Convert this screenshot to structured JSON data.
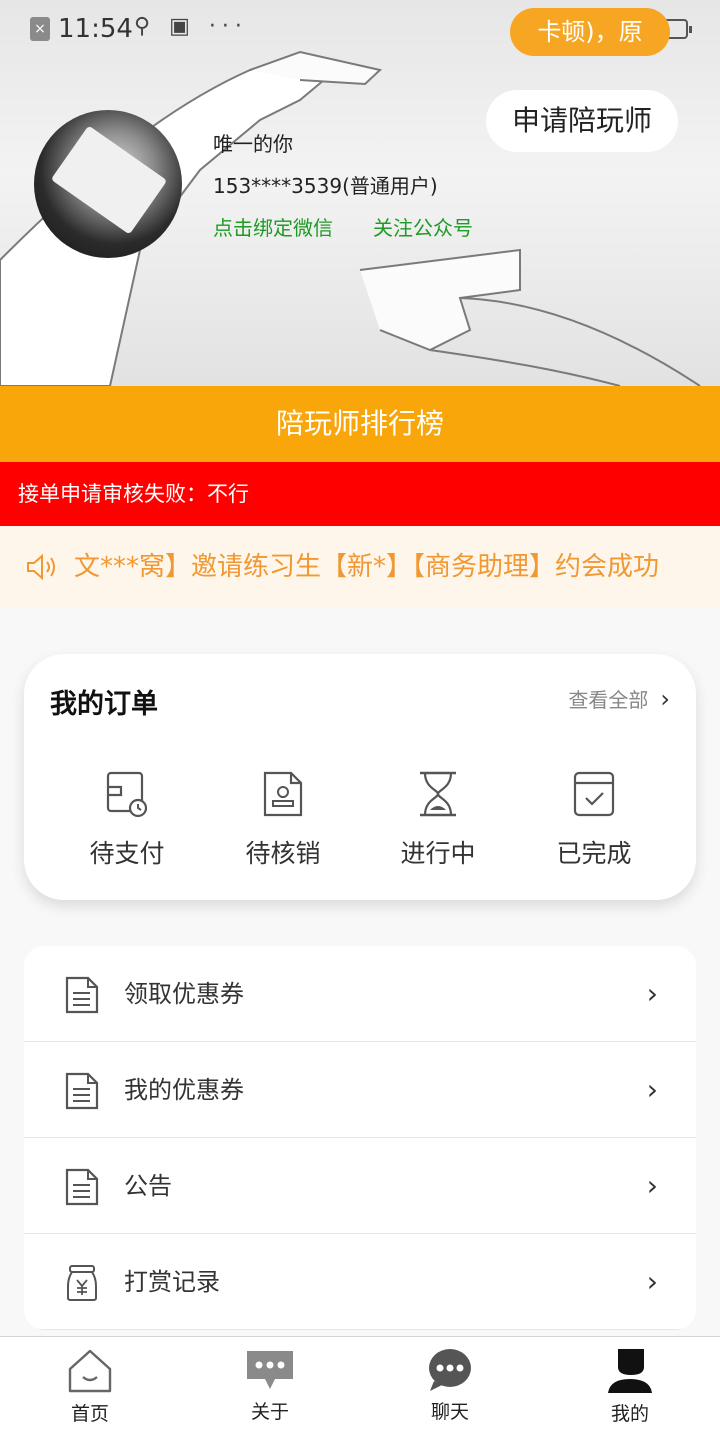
{
  "status_bar": {
    "time": "11:54",
    "toast": "卡顿)，原"
  },
  "profile": {
    "name": "唯一的你",
    "phone": "153****3539(普通用户)",
    "bind_wechat": "点击绑定微信",
    "follow_account": "关注公众号",
    "apply_button": "申请陪玩师"
  },
  "rank_bar": "陪玩师排行榜",
  "alert_bar": "接单申请审核失败：不行",
  "notice": {
    "icon": "speaker-icon",
    "text": "文***窝】邀请练习生【新*】【商务助理】约会成功"
  },
  "orders": {
    "title": "我的订单",
    "view_all": "查看全部",
    "items": [
      {
        "label": "待支付",
        "icon": "wallet-clock-icon"
      },
      {
        "label": "待核销",
        "icon": "stamp-document-icon"
      },
      {
        "label": "进行中",
        "icon": "hourglass-icon"
      },
      {
        "label": "已完成",
        "icon": "calendar-check-icon"
      }
    ]
  },
  "menu": [
    {
      "label": "领取优惠券",
      "icon": "document-icon"
    },
    {
      "label": "我的优惠券",
      "icon": "document-icon"
    },
    {
      "label": "公告",
      "icon": "document-icon"
    },
    {
      "label": "打赏记录",
      "icon": "yuan-jar-icon"
    }
  ],
  "tabbar": [
    {
      "label": "首页",
      "icon": "home-icon"
    },
    {
      "label": "关于",
      "icon": "message-icon"
    },
    {
      "label": "聊天",
      "icon": "chat-bubble-icon"
    },
    {
      "label": "我的",
      "icon": "user-icon"
    }
  ],
  "colors": {
    "accent_orange": "#f9a60b",
    "alert_red": "#ff0000",
    "link_green": "#1e9a25",
    "notice_text": "#f19833"
  }
}
